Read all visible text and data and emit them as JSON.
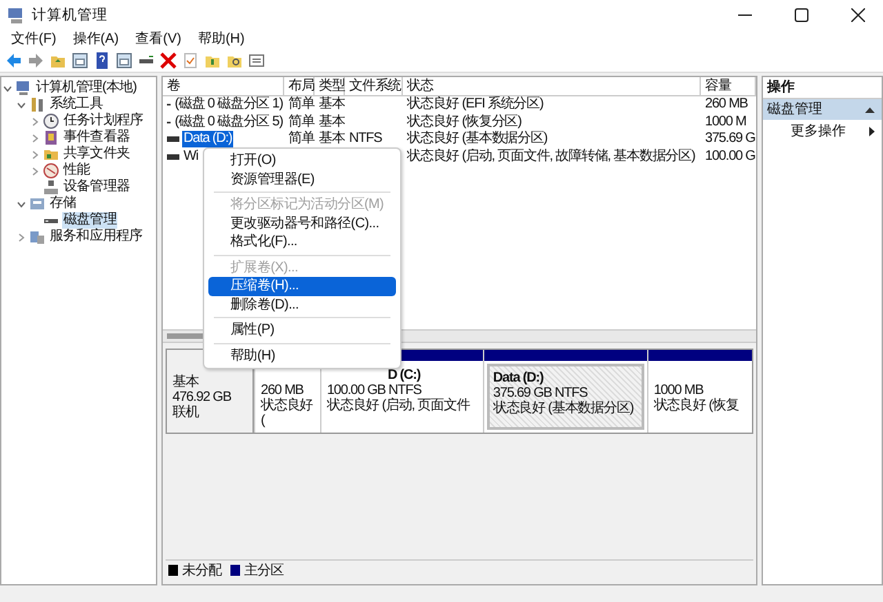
{
  "window": {
    "title": "计算机管理"
  },
  "menu": [
    "文件(F)",
    "操作(A)",
    "查看(V)",
    "帮助(H)"
  ],
  "tree": [
    {
      "label": "计算机管理(本地)",
      "kind": "computer",
      "expanded": true,
      "selected": false,
      "children": [
        {
          "label": "系统工具",
          "kind": "tools",
          "expanded": true,
          "selected": false,
          "children": [
            {
              "label": "任务计划程序",
              "kind": "clock",
              "expanded": false,
              "selected": false
            },
            {
              "label": "事件查看器",
              "kind": "event",
              "expanded": false,
              "selected": false
            },
            {
              "label": "共享文件夹",
              "kind": "folder",
              "expanded": false,
              "selected": false
            },
            {
              "label": "性能",
              "kind": "perf",
              "expanded": false,
              "selected": false
            },
            {
              "label": "设备管理器",
              "kind": "device",
              "selected": false
            }
          ]
        },
        {
          "label": "存储",
          "kind": "storage",
          "expanded": true,
          "selected": false,
          "children": [
            {
              "label": "磁盘管理",
              "kind": "disk",
              "selected": true
            }
          ]
        },
        {
          "label": "服务和应用程序",
          "kind": "services",
          "expanded": false,
          "selected": false
        }
      ]
    }
  ],
  "volumes": {
    "columns": [
      "卷",
      "布局",
      "类型",
      "文件系统",
      "状态",
      "容量"
    ],
    "rows": [
      {
        "cells": [
          "(磁盘 0 磁盘分区 1)",
          "简单",
          "基本",
          "",
          "状态良好 (EFI 系统分区)",
          "260 MB"
        ],
        "selected": false
      },
      {
        "cells": [
          "(磁盘 0 磁盘分区 5)",
          "简单",
          "基本",
          "",
          "状态良好 (恢复分区)",
          "1000 M"
        ],
        "selected": false
      },
      {
        "cells": [
          "Data (D:)",
          "简单",
          "基本",
          "NTFS",
          "状态良好 (基本数据分区)",
          "375.69 G"
        ],
        "selected": true
      },
      {
        "cells": [
          "Wi",
          "",
          "",
          "",
          "状态良好 (启动, 页面文件, 故障转储, 基本数据分区)",
          "100.00 G"
        ],
        "selected": false
      }
    ]
  },
  "disk": {
    "info": [
      "基本",
      "476.92 GB",
      "联机"
    ],
    "partitions": [
      {
        "lines": [
          "260 MB",
          "状态良好 ("
        ],
        "selected": false
      },
      {
        "name": "D  (C:)",
        "lines": [
          "100.00 GB NTFS",
          "状态良好 (启动, 页面文件"
        ],
        "selected": false
      },
      {
        "name": "Data  (D:)",
        "lines": [
          "375.69 GB NTFS",
          "状态良好 (基本数据分区)"
        ],
        "selected": true
      },
      {
        "lines": [
          "1000 MB",
          "状态良好 (恢复"
        ],
        "selected": false
      }
    ]
  },
  "legend": [
    {
      "label": "未分配",
      "color": "#000000"
    },
    {
      "label": "主分区",
      "color": "#000080"
    }
  ],
  "actions": {
    "title": "操作",
    "section": {
      "label": "磁盘管理",
      "expanded": true
    },
    "items": [
      "更多操作"
    ]
  },
  "context_menu": [
    {
      "kind": "item",
      "label": "打开(O)",
      "disabled": false,
      "selected": false
    },
    {
      "kind": "item",
      "label": "资源管理器(E)",
      "disabled": false,
      "selected": false
    },
    {
      "kind": "separator"
    },
    {
      "kind": "item",
      "label": "将分区标记为活动分区(M)",
      "disabled": true,
      "selected": false
    },
    {
      "kind": "item",
      "label": "更改驱动器号和路径(C)...",
      "disabled": false,
      "selected": false
    },
    {
      "kind": "item",
      "label": "格式化(F)...",
      "disabled": false,
      "selected": false
    },
    {
      "kind": "separator"
    },
    {
      "kind": "item",
      "label": "扩展卷(X)...",
      "disabled": true,
      "selected": false
    },
    {
      "kind": "item",
      "label": "压缩卷(H)...",
      "disabled": false,
      "selected": true
    },
    {
      "kind": "item",
      "label": "删除卷(D)...",
      "disabled": false,
      "selected": false
    },
    {
      "kind": "separator"
    },
    {
      "kind": "item",
      "label": "属性(P)",
      "disabled": false,
      "selected": false
    },
    {
      "kind": "separator"
    },
    {
      "kind": "item",
      "label": "帮助(H)",
      "disabled": false,
      "selected": false
    }
  ]
}
